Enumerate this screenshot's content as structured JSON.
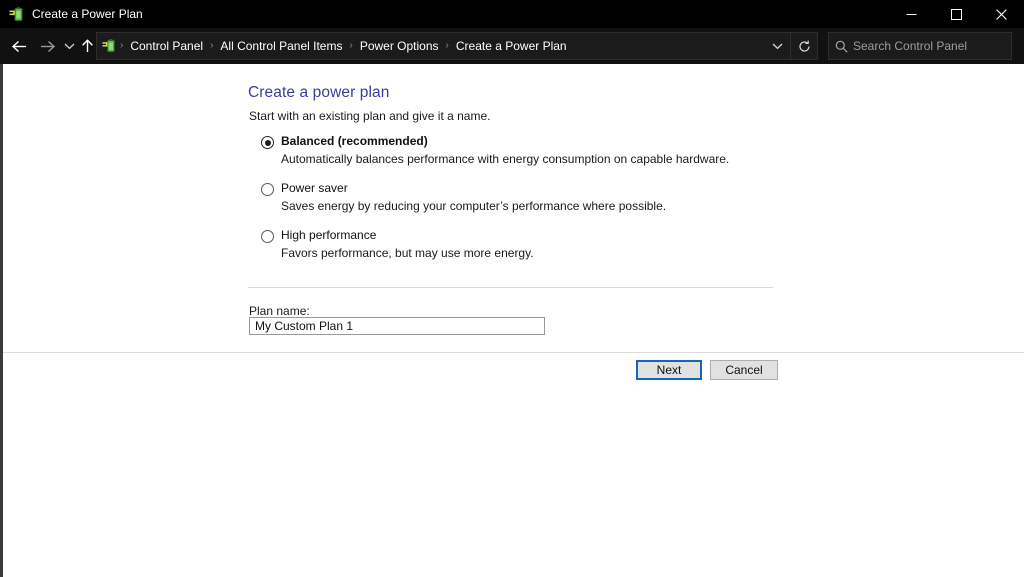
{
  "window": {
    "title": "Create a Power Plan",
    "icon": "power-plan-icon",
    "controls": {
      "minimize": "minimize-icon",
      "maximize": "maximize-icon",
      "close": "close-icon"
    }
  },
  "nav": {
    "back": "back-arrow-icon",
    "forward": "forward-arrow-icon",
    "recent": "recent-locations-chevron-icon",
    "up": "up-arrow-icon",
    "address_icon": "power-plan-icon",
    "breadcrumb": [
      "Control Panel",
      "All Control Panel Items",
      "Power Options",
      "Create a Power Plan"
    ],
    "separator": "›",
    "dropdown": "chevron-down-icon",
    "refresh": "refresh-icon"
  },
  "search": {
    "placeholder": "Search Control Panel",
    "value": "",
    "icon": "search-icon"
  },
  "main": {
    "title": "Create a power plan",
    "subtitle": "Start with an existing plan and give it a name.",
    "options": [
      {
        "label": "Balanced (recommended)",
        "description": "Automatically balances performance with energy consumption on capable hardware.",
        "selected": true
      },
      {
        "label": "Power saver",
        "description": "Saves energy by reducing your computer’s performance where possible.",
        "selected": false
      },
      {
        "label": "High performance",
        "description": "Favors performance, but may use more energy.",
        "selected": false
      }
    ],
    "plan_name_label": "Plan name:",
    "plan_name_value": "My Custom Plan 1",
    "plan_name_placeholder": ""
  },
  "footer": {
    "next_label": "Next",
    "cancel_label": "Cancel"
  },
  "colors": {
    "titlebar_bg": "#000000",
    "navbar_bg": "#111111",
    "content_bg": "#ffffff",
    "heading": "#3c3c9e",
    "accent_focus": "#1565c0",
    "battery_green": "#5bb54a"
  }
}
